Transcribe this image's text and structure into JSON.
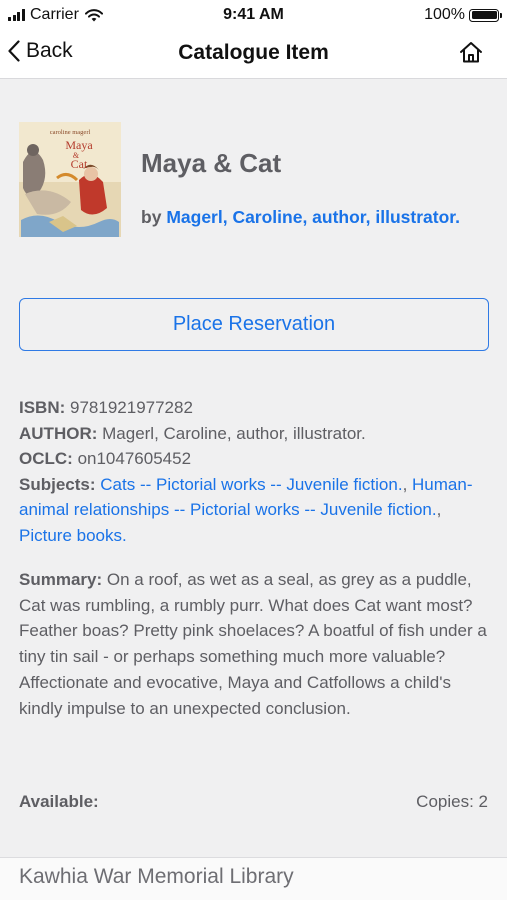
{
  "status_bar": {
    "carrier": "Carrier",
    "time": "9:41 AM",
    "battery": "100%",
    "battery_level": 1.0
  },
  "nav": {
    "back_label": "Back",
    "back_icon": "chevron-left-icon",
    "title": "Catalogue Item",
    "home_icon": "home-icon"
  },
  "item": {
    "title": "Maya & Cat",
    "by_prefix": "by",
    "author_link": "Magerl, Caroline, author, illustrator.",
    "cover_text_author": "caroline magerl",
    "cover_text_title_1": "Maya",
    "cover_text_title_2": "&",
    "cover_text_title_3": "Cat"
  },
  "actions": {
    "reserve_label": "Place Reservation"
  },
  "details": {
    "isbn_label": "ISBN:",
    "isbn": "9781921977282",
    "author_label": "AUTHOR:",
    "author": "Magerl, Caroline, author, illustrator.",
    "oclc_label": "OCLC:",
    "oclc": "on1047605452",
    "subjects_label": "Subjects:",
    "subjects": [
      "Cats -- Pictorial works -- Juvenile fiction.",
      "Human-animal relationships -- Pictorial works -- Juvenile fiction.",
      "Picture books."
    ],
    "separator": ", "
  },
  "summary": {
    "label": "Summary:",
    "text": "On a roof, as wet as a seal, as grey as a puddle, Cat was rumbling, a rumbly purr. What does Cat want most? Feather boas? Pretty pink shoelaces? A boatful of fish under a tiny tin sail - or perhaps something much more valuable? Affectionate and evocative, Maya and Catfollows a child's kindly impulse to an unexpected conclusion."
  },
  "availability": {
    "label": "Available:",
    "copies": "Copies: 2"
  },
  "footer": {
    "library": "Kawhia War Memorial Library"
  },
  "colors": {
    "link": "#1a73e8",
    "text": "#5e5e63",
    "background": "#f0f0f1"
  }
}
